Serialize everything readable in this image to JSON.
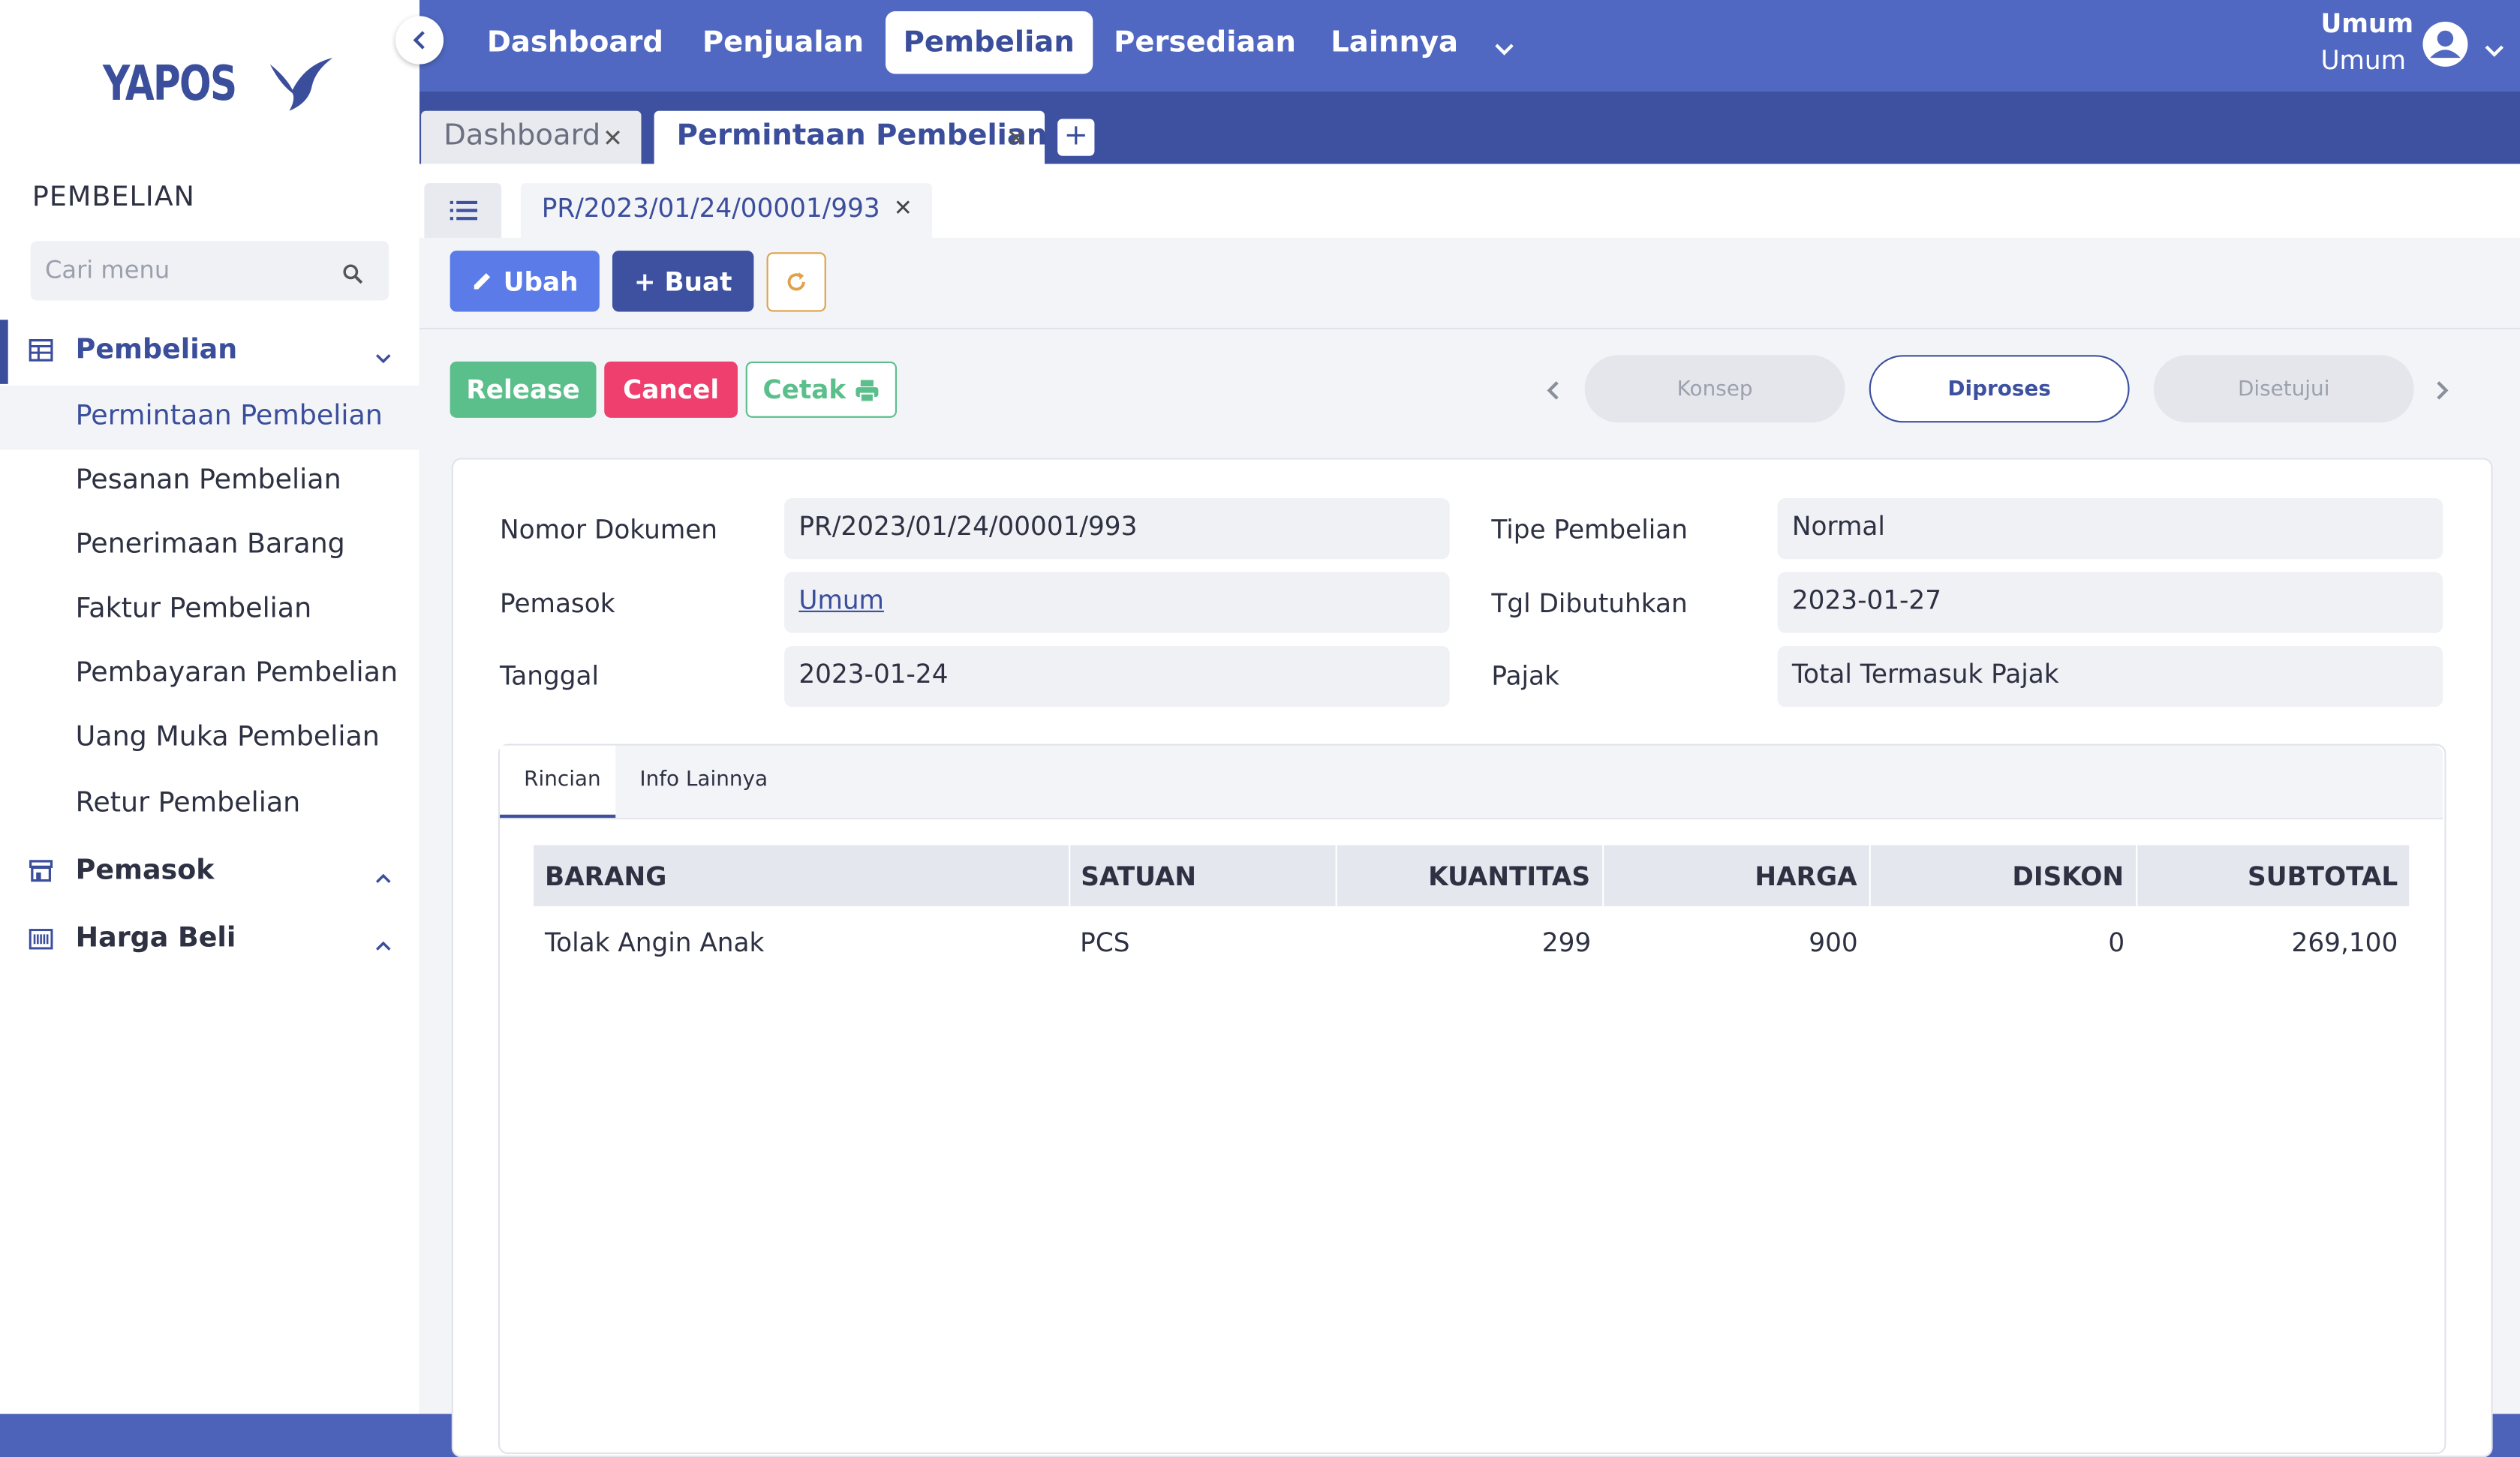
{
  "brand": {
    "logo_text": "YAPOS"
  },
  "sidebar": {
    "section_title": "PEMBELIAN",
    "search_placeholder": "Cari menu",
    "groups": [
      {
        "label": "Pembelian",
        "icon": "table-icon",
        "expanded": true,
        "items": [
          {
            "label": "Permintaan Pembelian",
            "active": true
          },
          {
            "label": "Pesanan Pembelian"
          },
          {
            "label": "Penerimaan Barang"
          },
          {
            "label": "Faktur Pembelian"
          },
          {
            "label": "Pembayaran Pembelian"
          },
          {
            "label": "Uang Muka Pembelian"
          },
          {
            "label": "Retur Pembelian"
          }
        ]
      },
      {
        "label": "Pemasok",
        "icon": "store-icon",
        "expanded": false
      },
      {
        "label": "Harga Beli",
        "icon": "barcode-icon",
        "expanded": false
      }
    ]
  },
  "topnav": {
    "items": [
      "Dashboard",
      "Penjualan",
      "Pembelian",
      "Persediaan",
      "Lainnya"
    ],
    "active": "Pembelian",
    "user": {
      "line1": "Umum",
      "line2": "Umum"
    }
  },
  "window_tabs": [
    {
      "label": "Dashboard",
      "active": false
    },
    {
      "label": "Permintaan Pembelian",
      "active": true
    }
  ],
  "document_tab": {
    "label": "PR/2023/01/24/00001/993"
  },
  "toolbar": {
    "edit_label": "Ubah",
    "create_label": "+ Buat"
  },
  "actions": {
    "release": "Release",
    "cancel": "Cancel",
    "print": "Cetak"
  },
  "status_steps": [
    {
      "label": "Konsep",
      "active": false
    },
    {
      "label": "Diproses",
      "active": true
    },
    {
      "label": "Disetujui",
      "active": false
    }
  ],
  "form": {
    "nomor_dokumen": {
      "label": "Nomor Dokumen",
      "value": "PR/2023/01/24/00001/993"
    },
    "pemasok": {
      "label": "Pemasok",
      "value": "Umum"
    },
    "tanggal": {
      "label": "Tanggal",
      "value": "2023-01-24"
    },
    "tipe_pembelian": {
      "label": "Tipe Pembelian",
      "value": "Normal"
    },
    "tgl_dibutuhkan": {
      "label": "Tgl Dibutuhkan",
      "value": "2023-01-27"
    },
    "pajak": {
      "label": "Pajak",
      "value": "Total Termasuk Pajak"
    }
  },
  "detail_tabs": [
    "Rincian",
    "Info Lainnya"
  ],
  "table": {
    "columns": [
      "BARANG",
      "SATUAN",
      "KUANTITAS",
      "HARGA",
      "DISKON",
      "SUBTOTAL"
    ],
    "rows": [
      [
        "Tolak Angin Anak",
        "PCS",
        "299",
        "900",
        "0",
        "269,100"
      ]
    ]
  },
  "colors": {
    "primary": "#3d51a0",
    "nav": "#5068c1",
    "release": "#5bbf8b",
    "cancel": "#ee3f6e",
    "edit": "#5a7be8"
  }
}
